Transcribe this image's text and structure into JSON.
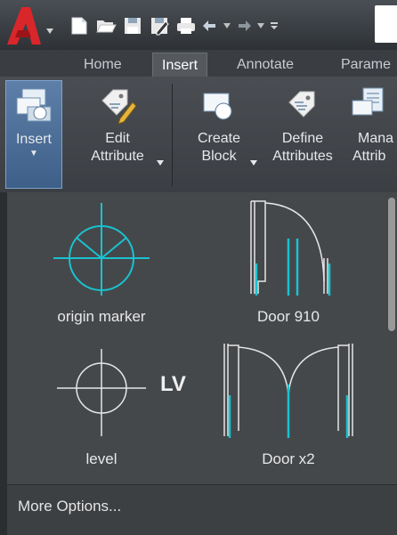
{
  "colors": {
    "accent_red": "#d9262b",
    "symbol_cyan": "#19c2cf",
    "symbol_white": "#e6e6e6",
    "selected_blue": "#4d6f98"
  },
  "quick_access": {
    "icons": [
      "new-icon",
      "open-icon",
      "save-icon",
      "save-as-icon",
      "plot-icon",
      "undo-icon",
      "redo-icon",
      "dropdown-icon"
    ]
  },
  "tabs": [
    {
      "label": "Home",
      "active": false
    },
    {
      "label": "Insert",
      "active": true
    },
    {
      "label": "Annotate",
      "active": false
    },
    {
      "label": "Parame",
      "active": false
    }
  ],
  "ribbon": {
    "insert": {
      "label": "Insert",
      "icon": "insert-block-icon",
      "selected": true
    },
    "edit_attribute": {
      "line1": "Edit",
      "line2": "Attribute",
      "icon": "edit-attribute-icon"
    },
    "create_block": {
      "line1": "Create",
      "line2": "Block",
      "icon": "create-block-icon"
    },
    "define_attributes": {
      "line1": "Define",
      "line2": "Attributes",
      "icon": "define-attributes-icon"
    },
    "manage_attributes": {
      "line1": "Mana",
      "line2": "Attrib",
      "icon": "manage-attributes-icon"
    }
  },
  "gallery": {
    "items": [
      {
        "label": "origin marker",
        "symbol": "origin-marker-icon"
      },
      {
        "label": "Door 910",
        "symbol": "door-910-icon"
      },
      {
        "label": "level",
        "symbol": "level-icon",
        "tag": "LV"
      },
      {
        "label": "Door x2",
        "symbol": "door-x2-icon"
      }
    ]
  },
  "more_options": "More Options..."
}
